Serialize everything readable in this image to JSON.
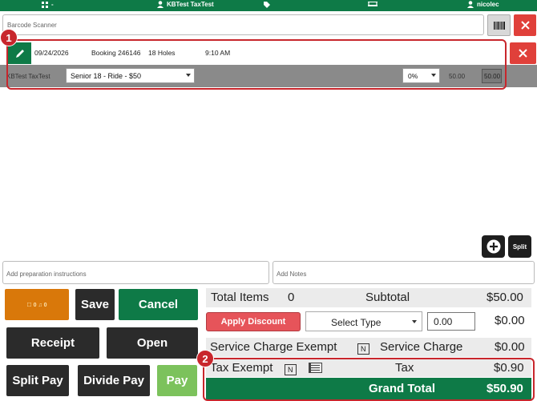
{
  "topbar": {
    "left_text": "-",
    "user_title": "KBTest TaxTest",
    "right_user": "nicolec",
    "icons": [
      "grid-icon",
      "person-icon",
      "tag-icon",
      "golf-cart-icon",
      "person-icon"
    ]
  },
  "scanner": {
    "placeholder": "Barcode Scanner"
  },
  "booking": {
    "date": "09/24/2026",
    "booking": "Booking 246146",
    "holes": "18 Holes",
    "time": "9:10 AM"
  },
  "item": {
    "owner": "KBTest TaxTest",
    "selected_rate": "Senior 18 - Ride - $50",
    "discount_pct": "0%",
    "price": "50.00",
    "total": "50.00"
  },
  "badges": {
    "one": "1",
    "two": "2"
  },
  "actions": {
    "split_label": "Split"
  },
  "inputs": {
    "prep_placeholder": "Add preparation instructions",
    "notes_placeholder": "Add Notes"
  },
  "buttons": {
    "preset": "☐ 0 ♫ 0",
    "save": "Save",
    "cancel": "Cancel",
    "receipt": "Receipt",
    "open": "Open",
    "split_pay": "Split Pay",
    "divide_pay": "Divide Pay",
    "pay": "Pay"
  },
  "summary": {
    "total_items_label": "Total Items",
    "total_items": "0",
    "subtotal_label": "Subtotal",
    "subtotal": "$50.00",
    "apply_discount": "Apply Discount",
    "select_type": "Select Type",
    "discount_value": "0.00",
    "discount_amount": "$0.00",
    "service_exempt_label": "Service Charge Exempt",
    "service_exempt_flag": "N",
    "service_charge_label": "Service Charge",
    "service_charge": "$0.00",
    "tax_exempt_label": "Tax Exempt",
    "tax_exempt_flag": "N",
    "tax_label": "Tax",
    "tax": "$0.90",
    "grand_total_label": "Grand Total",
    "grand_total": "$50.90"
  },
  "colors": {
    "brand_green": "#0e7a47",
    "danger_red": "#e0403a",
    "annotation_red": "#c8262c",
    "pay_green": "#7cc25c",
    "preset_orange": "#d9780a"
  }
}
